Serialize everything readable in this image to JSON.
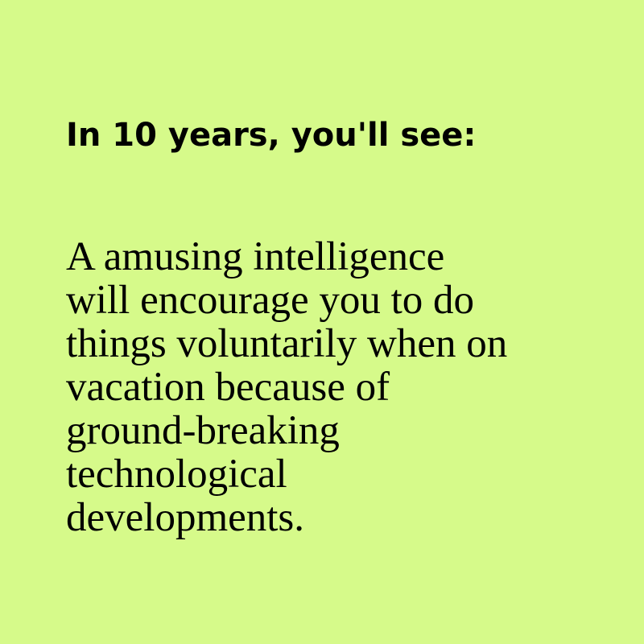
{
  "heading": "In 10 years, you'll see:",
  "prediction_lines": [
    "A amusing intelligence",
    "will encourage you to do",
    "things voluntarily when on",
    "vacation because of",
    "ground-breaking",
    "technological",
    "developments."
  ],
  "colors": {
    "background": "#d6fa8a",
    "text": "#000000"
  }
}
